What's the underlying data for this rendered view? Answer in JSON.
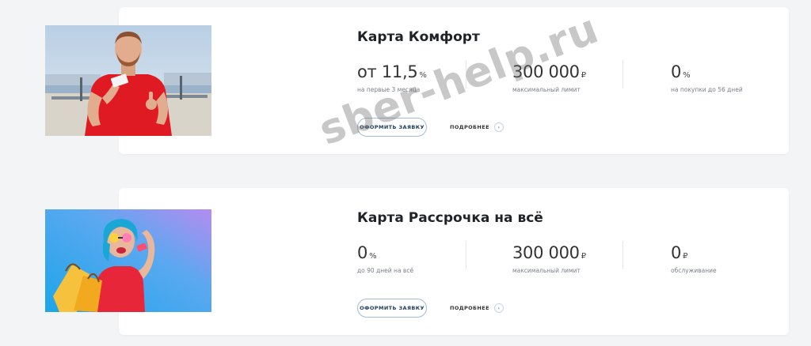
{
  "cards": [
    {
      "title": "Карта Комфорт",
      "stats": [
        {
          "value": "от 11,5",
          "unit": "%",
          "label": "на первые 3 месяца"
        },
        {
          "value": "300 000",
          "unit": "₽",
          "label": "максимальный лимит"
        },
        {
          "value": "0",
          "unit": "%",
          "label": "на покупки до 56 дней"
        }
      ],
      "apply_label": "ОФОРМИТЬ ЗАЯВКУ",
      "more_label": "ПОДРОБНЕЕ",
      "more_icon": "chevron-right-icon"
    },
    {
      "title": "Карта Рассрочка на всё",
      "stats": [
        {
          "value": "0",
          "unit": "%",
          "label": "до 90 дней на всё"
        },
        {
          "value": "300 000",
          "unit": "₽",
          "label": "максимальный лимит"
        },
        {
          "value": "0",
          "unit": "₽",
          "label": "обслуживание"
        }
      ],
      "apply_label": "ОФОРМИТЬ ЗАЯВКУ",
      "more_label": "ПОДРОБНЕЕ",
      "more_icon": "chevron-right-icon"
    }
  ],
  "watermark": "sber-help.ru",
  "colors": {
    "page_bg": "#f3f4f6",
    "card_bg": "#ffffff",
    "button_border": "#9fbcd8",
    "shirt_red": "#e01a22",
    "photo2_gradient": [
      "#1ea5e9",
      "#b58cf0"
    ]
  }
}
